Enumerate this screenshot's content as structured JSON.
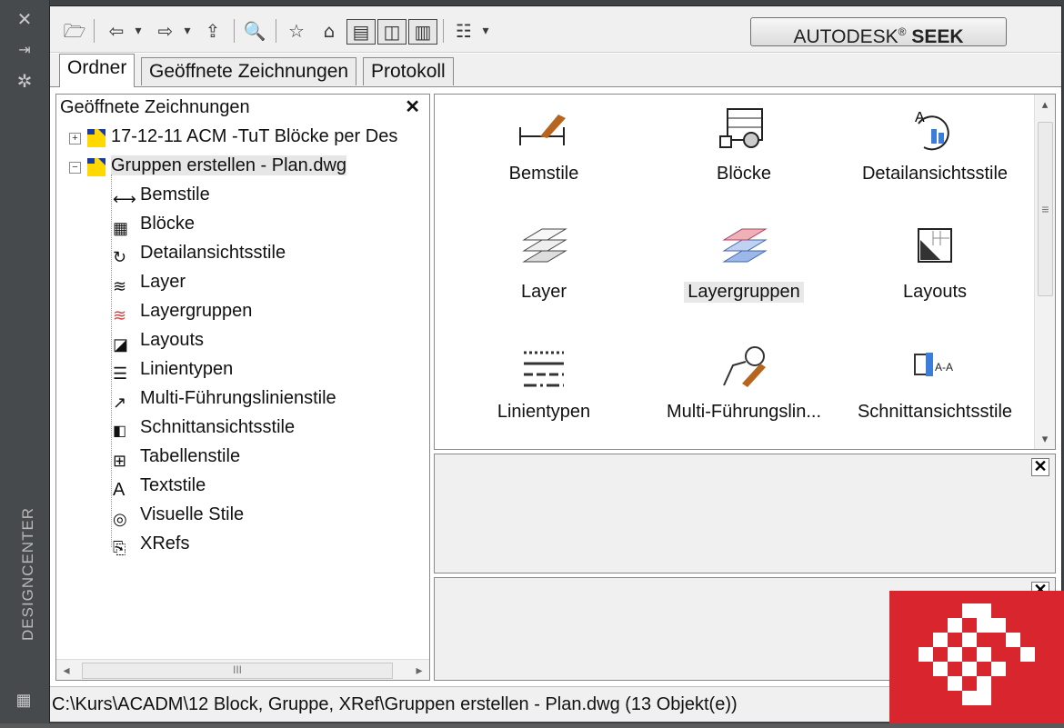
{
  "sidebar": {
    "title": "DESIGNCENTER",
    "buttons": [
      "close-icon",
      "auto-hide-icon",
      "properties-icon"
    ]
  },
  "toolbar": {
    "seek_brand": "AUTODESK",
    "seek_registered": "®",
    "seek_word": "SEEK"
  },
  "tabs": [
    {
      "label": "Ordner",
      "active": true
    },
    {
      "label": "Geöffnete Zeichnungen",
      "active": false
    },
    {
      "label": "Protokoll",
      "active": false
    }
  ],
  "tree": {
    "header": "Geöffnete Zeichnungen",
    "close_glyph": "✕",
    "drawings": [
      {
        "label": "17-12-11 ACM -TuT Blöcke per Des",
        "expander": "+"
      },
      {
        "label": "Gruppen erstellen - Plan.dwg",
        "expander": "−"
      }
    ],
    "children": [
      {
        "label": "Bemstile",
        "icon": "dimstyle-icon"
      },
      {
        "label": "Blöcke",
        "icon": "block-icon"
      },
      {
        "label": "Detailansichtsstile",
        "icon": "detailview-icon"
      },
      {
        "label": "Layer",
        "icon": "layer-icon"
      },
      {
        "label": "Layergruppen",
        "icon": "layergroup-icon"
      },
      {
        "label": "Layouts",
        "icon": "layout-icon"
      },
      {
        "label": "Linientypen",
        "icon": "linetype-icon"
      },
      {
        "label": "Multi-Führungslinienstile",
        "icon": "mleader-icon"
      },
      {
        "label": "Schnittansichtsstile",
        "icon": "sectionview-icon"
      },
      {
        "label": "Tabellenstile",
        "icon": "tablestyle-icon"
      },
      {
        "label": "Textstile",
        "icon": "textstyle-icon"
      },
      {
        "label": "Visuelle Stile",
        "icon": "visualstyle-icon"
      },
      {
        "label": "XRefs",
        "icon": "xref-icon"
      }
    ],
    "scroll_thumb": "III"
  },
  "content": {
    "items": [
      {
        "label": "Bemstile"
      },
      {
        "label": "Blöcke"
      },
      {
        "label": "Detailansichtsstile"
      },
      {
        "label": "Layer"
      },
      {
        "label": "Layergruppen"
      },
      {
        "label": "Layouts"
      },
      {
        "label": "Linientypen"
      },
      {
        "label": "Multi-Führungslin..."
      },
      {
        "label": "Schnittansichtsstile"
      }
    ],
    "scroll_thumb": "≡"
  },
  "panes": {
    "close_glyph": "✕"
  },
  "status": {
    "text": "C:\\Kurs\\ACADM\\12 Block, Gruppe, XRef\\Gruppen erstellen - Plan.dwg (13 Objekt(e))"
  },
  "colors": {
    "logo_red": "#d9262e",
    "panel_dark": "#474a4d"
  }
}
